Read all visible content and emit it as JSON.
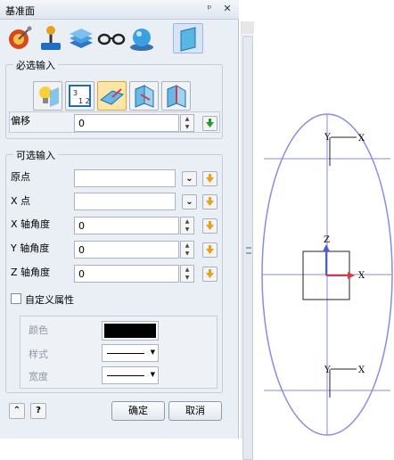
{
  "panel": {
    "title": "基准面",
    "pin_icon": "pin-icon",
    "close_icon": "close-icon",
    "toolbar_icons": [
      "satellite-dish-icon",
      "joystick-icon",
      "layers-stack-icon",
      "glasses-icon",
      "sphere-icon",
      "datum-plane-icon"
    ]
  },
  "required": {
    "legend": "必选输入",
    "type_buttons": [
      "lightbulb-plane-icon",
      "grid-numbers-icon",
      "inclined-plane-icon",
      "corner-plane-icon",
      "edge-plane-icon"
    ],
    "offset_label": "偏移",
    "offset_value": "0"
  },
  "optional": {
    "legend": "可选输入",
    "origin_label": "原点",
    "origin_value": "",
    "xpoint_label": "X 点",
    "xpoint_value": "",
    "x_angle_label": "X 轴角度",
    "x_angle_value": "0",
    "y_angle_label": "Y 轴角度",
    "y_angle_value": "0",
    "z_angle_label": "Z 轴角度",
    "z_angle_value": "0",
    "custom_attr_label": "自定义属性",
    "color_label": "颜色",
    "style_label": "样式",
    "width_label": "宽度"
  },
  "footer": {
    "ok_label": "确定",
    "cancel_label": "取消"
  },
  "viewport": {
    "top_y": "Y",
    "top_x": "X",
    "z_label": "Z",
    "mid_x": "X",
    "bot_y": "Y",
    "bot_x": "X"
  },
  "colors": {
    "panel_bg": "#eaeff6",
    "ellipse": "#8a8ae8",
    "axis_z": "#4a5ed8",
    "axis_x": "#d83a4a"
  }
}
